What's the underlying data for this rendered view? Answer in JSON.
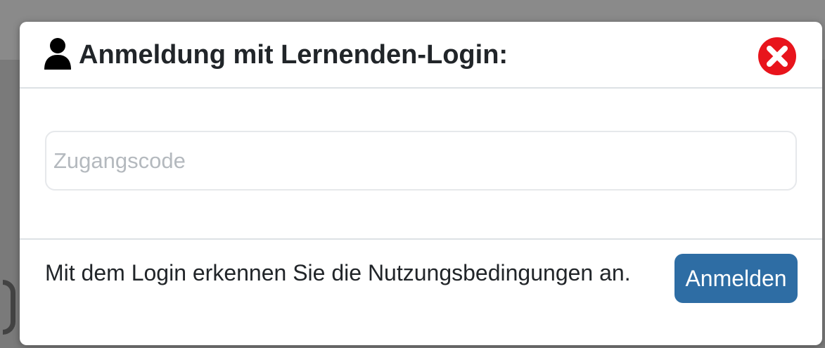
{
  "dialog": {
    "title": "Anmeldung mit Lernenden-Login:",
    "title_icon": "user-icon",
    "close_icon": "close-circle-icon",
    "colors": {
      "close": "#e8141c",
      "button": "#2e6da4"
    }
  },
  "form": {
    "access_code_placeholder": "Zugangscode",
    "access_code_value": ""
  },
  "footer": {
    "terms_text": "Mit dem Login erkennen Sie die Nutzungsbedingungen an.",
    "login_label": "Anmelden"
  }
}
